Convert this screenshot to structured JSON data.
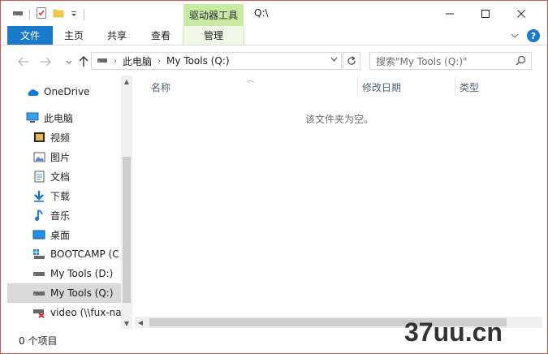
{
  "titlebar": {
    "context_tab": "驱动器工具",
    "title": "Q:\\"
  },
  "ribbon": {
    "tabs": [
      "文件",
      "主页",
      "共享",
      "查看",
      "管理"
    ],
    "help": "?"
  },
  "address": {
    "crumbs": [
      "此电脑",
      "My Tools (Q:)"
    ]
  },
  "search": {
    "placeholder": "搜索\"My Tools (Q:)\""
  },
  "nav_pane": {
    "items": [
      {
        "label": "OneDrive",
        "icon": "onedrive-icon"
      },
      {
        "label": "此电脑",
        "icon": "computer-icon"
      },
      {
        "label": "视频",
        "icon": "video-folder-icon"
      },
      {
        "label": "图片",
        "icon": "pictures-folder-icon"
      },
      {
        "label": "文档",
        "icon": "documents-folder-icon"
      },
      {
        "label": "下载",
        "icon": "downloads-folder-icon"
      },
      {
        "label": "音乐",
        "icon": "music-folder-icon"
      },
      {
        "label": "桌面",
        "icon": "desktop-folder-icon"
      },
      {
        "label": "BOOTCAMP (C",
        "icon": "windows-drive-icon"
      },
      {
        "label": "My Tools (D:)",
        "icon": "drive-icon"
      },
      {
        "label": "My Tools (Q:)",
        "icon": "drive-icon",
        "selected": true
      },
      {
        "label": "video (\\\\fux-na",
        "icon": "network-drive-disconnected-icon"
      }
    ]
  },
  "content": {
    "columns": [
      "名称",
      "修改日期",
      "类型"
    ],
    "empty_message": "该文件夹为空。"
  },
  "status": {
    "item_count": "0 个项目"
  },
  "watermark": "37uu.cn",
  "colors": {
    "file_tab": "#1979ca",
    "context_tab": "#c8eaa3",
    "window_border": "#d9534f"
  }
}
